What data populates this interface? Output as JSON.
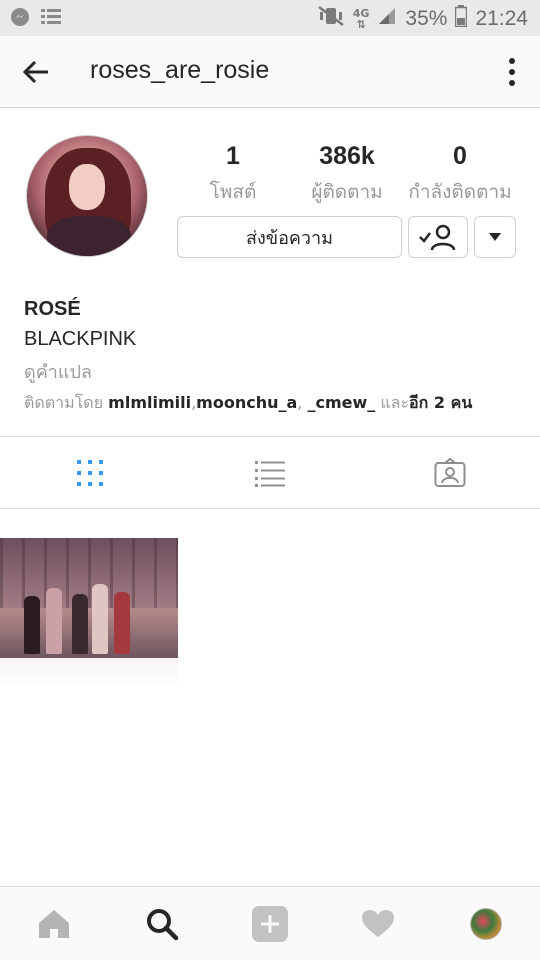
{
  "status_bar": {
    "battery_percent": "35%",
    "time": "21:24",
    "network": "4G",
    "icons": [
      "messenger-icon",
      "list-icon",
      "mute-vibrate-icon",
      "network-4g-icon",
      "signal-icon",
      "battery-icon"
    ]
  },
  "top_bar": {
    "username": "roses_are_rosie",
    "back_icon": "back-arrow-icon",
    "more_icon": "more-options-icon"
  },
  "profile": {
    "stats": [
      {
        "value": "1",
        "label": "โพสต์"
      },
      {
        "value": "386k",
        "label": "ผู้ติดตาม"
      },
      {
        "value": "0",
        "label": "กำลังติดตาม"
      }
    ],
    "message_button": "ส่งข้อความ",
    "name": "ROSÉ",
    "bio": "BLACKPINK",
    "translate_link": "ดูคำแปล",
    "followed_by": {
      "prefix": "ติดตามโดย",
      "users": "mlmlimili",
      "sep1": ",",
      "user2": "moonchu_a",
      "sep2": ", ",
      "user3": "_cmew_",
      "conj": " และ",
      "more": "อีก 2 คน"
    }
  },
  "view_tabs": [
    {
      "name": "grid",
      "icon": "grid-icon",
      "active": true
    },
    {
      "name": "list",
      "icon": "list-view-icon",
      "active": false
    },
    {
      "name": "tagged",
      "icon": "tagged-photos-icon",
      "active": false
    }
  ],
  "colors": {
    "accent": "#3897f0",
    "muted": "#999999",
    "text": "#262626"
  },
  "bottom_nav": [
    {
      "name": "home",
      "icon": "home-icon"
    },
    {
      "name": "search",
      "icon": "search-icon",
      "active": true
    },
    {
      "name": "new-post",
      "icon": "add-post-icon"
    },
    {
      "name": "activity",
      "icon": "heart-icon"
    },
    {
      "name": "profile",
      "icon": "profile-avatar-icon"
    }
  ]
}
